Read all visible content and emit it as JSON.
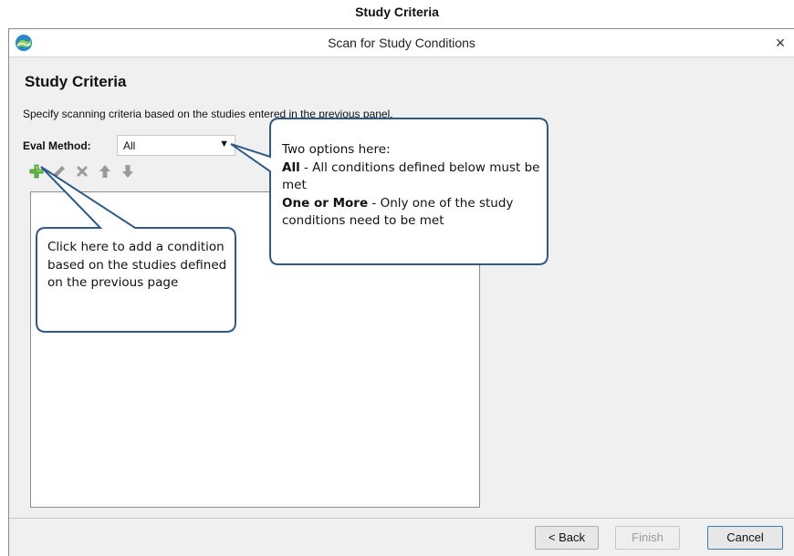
{
  "caption": "Study Criteria",
  "window": {
    "title": "Scan for Study Conditions",
    "close_symbol": "×"
  },
  "panel": {
    "heading": "Study Criteria",
    "description": "Specify scanning criteria based on the studies entered in the previous panel."
  },
  "eval": {
    "label": "Eval Method:",
    "selected": "All"
  },
  "toolbar": {
    "icons": [
      "add-icon",
      "edit-icon",
      "delete-icon",
      "move-up-icon",
      "move-down-icon"
    ]
  },
  "callouts": {
    "options": {
      "intro": "Two options here:",
      "all_term": "All",
      "all_text": " - All conditions defined below must be met",
      "one_term": "One or More",
      "one_text": " - Only one of the study conditions need to be met"
    },
    "add": {
      "text": "Click here to add a condition based on the studies defined on the previous page"
    }
  },
  "buttons": {
    "back": "< Back",
    "finish": "Finish",
    "cancel": "Cancel"
  },
  "colors": {
    "accent": "#3c7fb1",
    "callout_border": "#2e5b8a",
    "add_icon": "#62b543"
  }
}
